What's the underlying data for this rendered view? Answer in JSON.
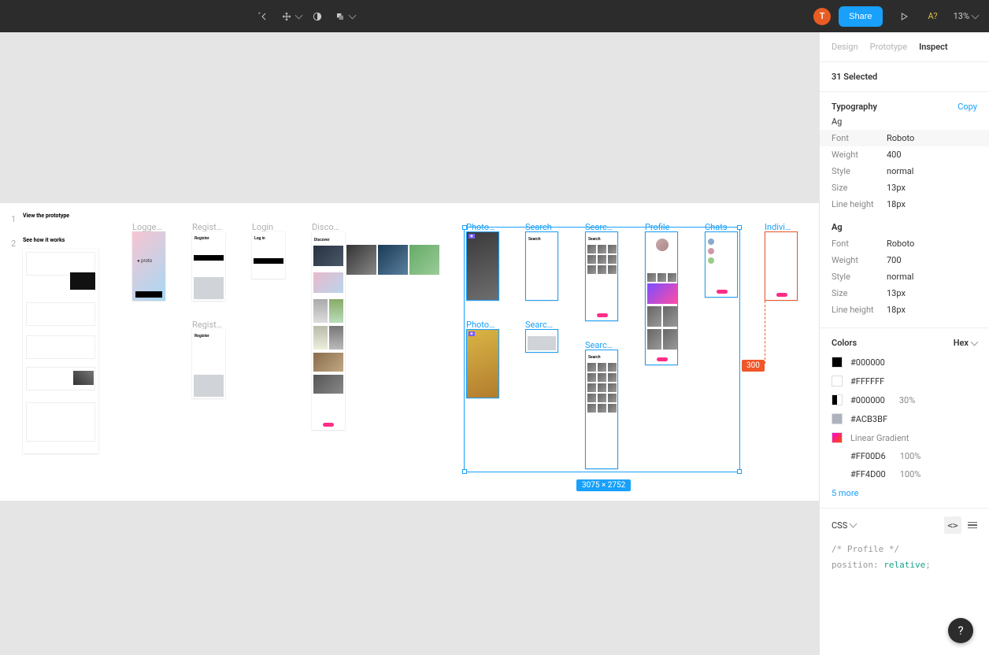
{
  "toolbar": {
    "avatar_initial": "T",
    "share_label": "Share",
    "iq": "A?",
    "zoom": "13%"
  },
  "panel": {
    "tabs": {
      "design": "Design",
      "prototype": "Prototype",
      "inspect": "Inspect"
    },
    "selected": "31 Selected",
    "typography": {
      "title": "Typography",
      "copy": "Copy",
      "groups": [
        {
          "sample": "Ag",
          "props": {
            "Font": "Roboto",
            "Weight": "400",
            "Style": "normal",
            "Size": "13px",
            "Line height": "18px"
          }
        },
        {
          "sample": "Ag",
          "props": {
            "Font": "Roboto",
            "Weight": "700",
            "Style": "normal",
            "Size": "13px",
            "Line height": "18px"
          }
        }
      ]
    },
    "colors": {
      "title": "Colors",
      "mode": "Hex",
      "items": [
        {
          "hex": "#000000",
          "swatch": "#000000"
        },
        {
          "hex": "#FFFFFF",
          "swatch": "#FFFFFF"
        },
        {
          "hex": "#000000",
          "swatch": "split",
          "pct": "30%"
        },
        {
          "hex": "#ACB3BF",
          "swatch": "#ACB3BF"
        },
        {
          "label": "Linear Gradient",
          "swatch": "gradient"
        },
        {
          "hex": "#FF00D6",
          "pct": "100%",
          "indent": true
        },
        {
          "hex": "#FF4D00",
          "pct": "100%",
          "indent": true
        }
      ],
      "more": "5 more"
    },
    "css": {
      "lang": "CSS",
      "comment": "/* Profile */",
      "line": "position:",
      "rel": " relative",
      "tail": ";"
    }
  },
  "pages": {
    "p1": "1",
    "p2": "2",
    "view_proto": "View the prototype",
    "see_how": "See how it works"
  },
  "frames": {
    "logged": "Logge…",
    "regist": "Regist…",
    "regist2": "Regist…",
    "login": "Login",
    "disco": "Disco…",
    "photo": "Photo…",
    "photo2": "Photo…",
    "search": "Search",
    "search2": "Searc…",
    "searc": "Searc…",
    "searc2": "Searc…",
    "profile": "Profile",
    "chats": "Chats",
    "indiv": "Indivi…"
  },
  "overlay": {
    "dims": "3075 × 2752",
    "dist": "300"
  },
  "mini": {
    "register": "Register",
    "login": "Log in",
    "discover": "Discover",
    "search": "Search",
    "proto": "proto"
  }
}
